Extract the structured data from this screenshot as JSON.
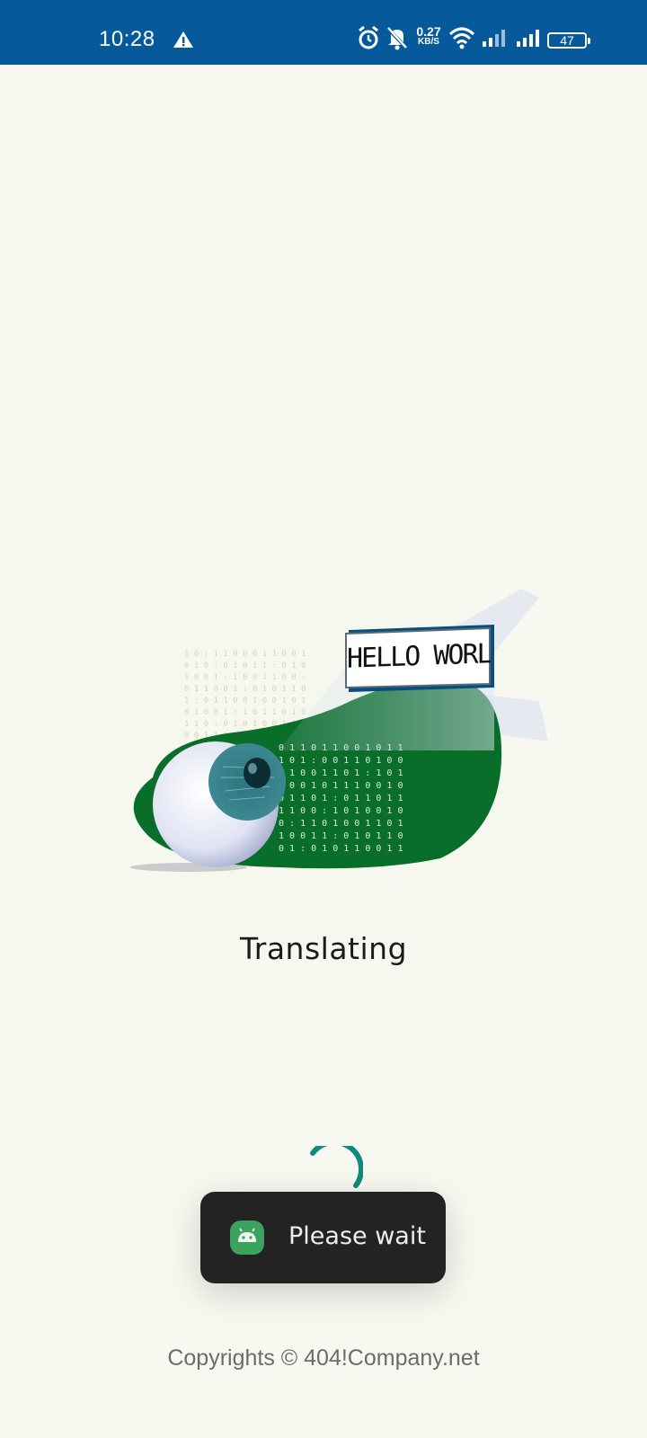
{
  "status_bar": {
    "time": "10:28",
    "net_speed_value": "0.27",
    "net_speed_unit": "KB/S",
    "battery": "47",
    "icons": [
      "warning-icon",
      "alarm-icon",
      "bell-off-icon",
      "wifi-icon",
      "signal-icon",
      "signal-icon",
      "battery-icon"
    ]
  },
  "illustration": {
    "banner_text": "HELLO WORLD!",
    "accent_color": "#0a6e2b"
  },
  "main": {
    "status_label": "Translating"
  },
  "toast": {
    "icon": "android-icon",
    "message": "Please wait"
  },
  "footer": {
    "copyright": "Copyrights © 404!Company.net"
  },
  "colors": {
    "status_bar_bg": "#065a9c",
    "page_bg": "#f7f9f1",
    "spinner": "#0f8a7e",
    "toast_bg": "#232323"
  }
}
